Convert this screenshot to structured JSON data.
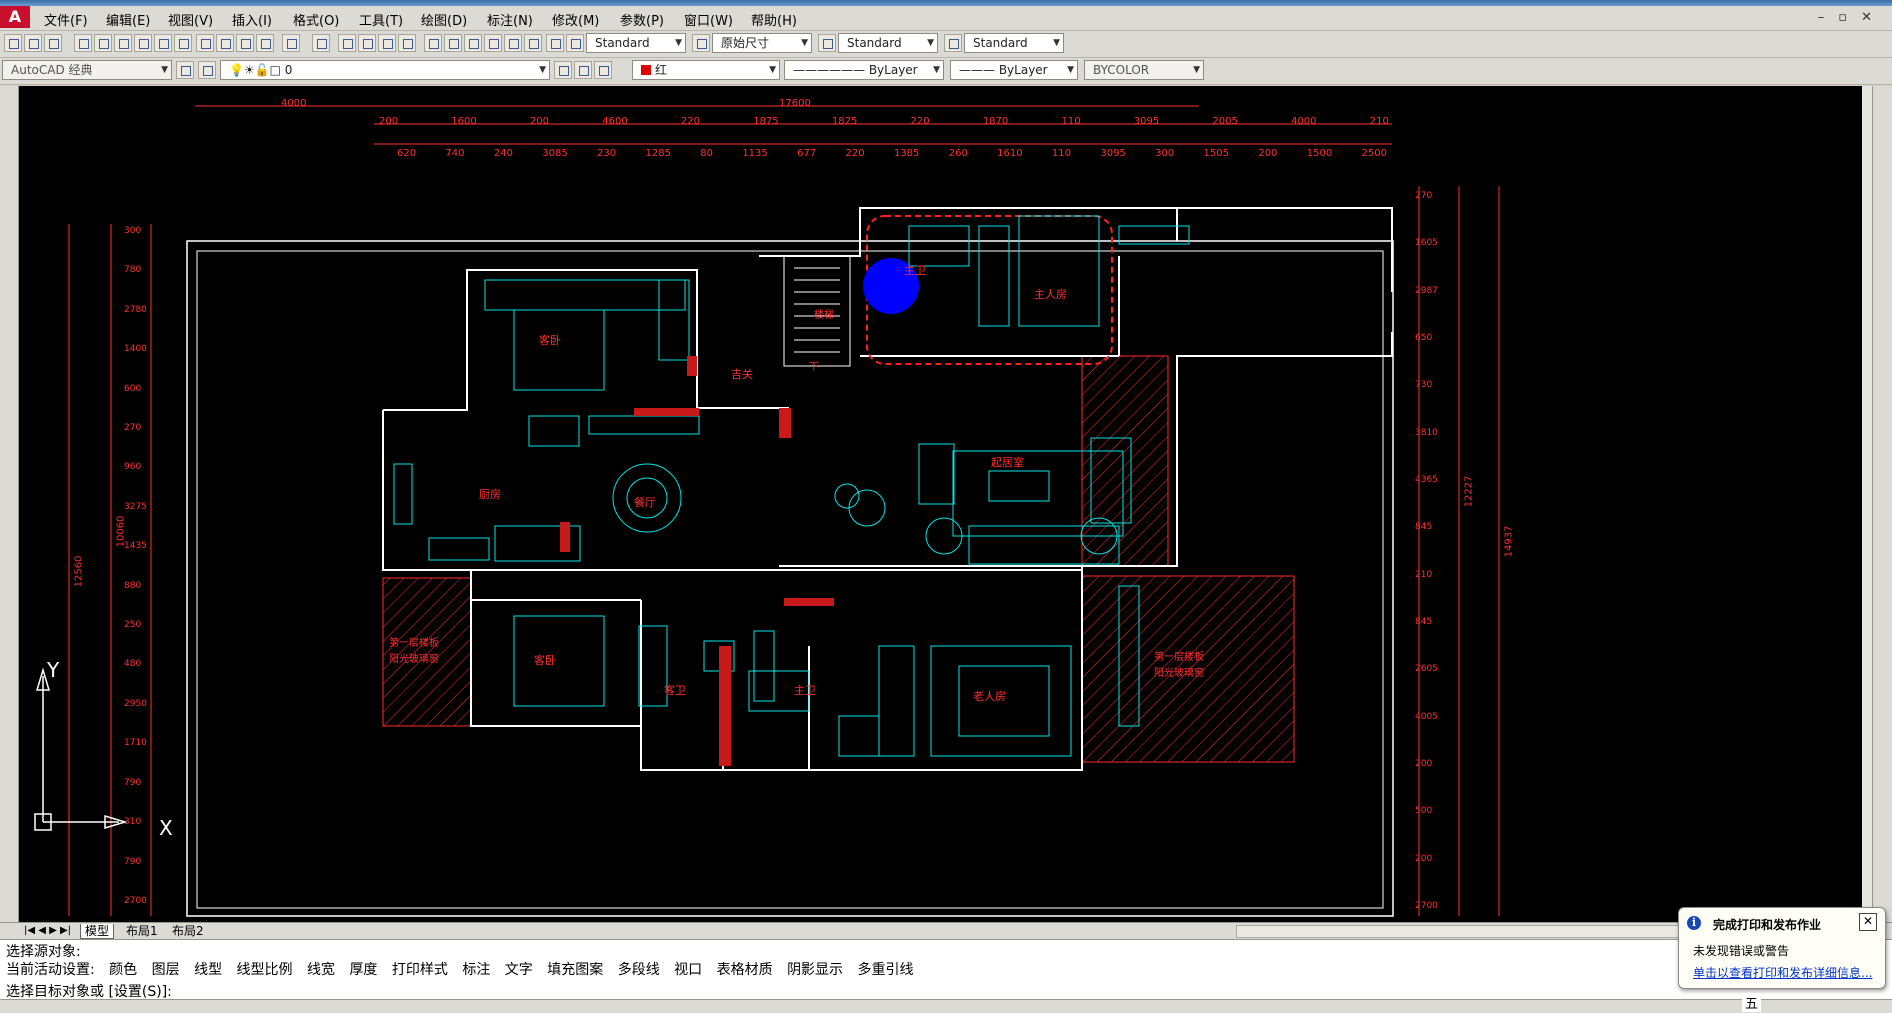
{
  "menubar": {
    "items": [
      "文件(F)",
      "编辑(E)",
      "视图(V)",
      "插入(I)",
      "格式(O)",
      "工具(T)",
      "绘图(D)",
      "标注(N)",
      "修改(M)",
      "参数(P)",
      "窗口(W)",
      "帮助(H)"
    ]
  },
  "toolbar1": {
    "text_style": "Standard",
    "dim_style": "原始尺寸",
    "table_style": "Standard",
    "multileader_style": "Standard"
  },
  "toolbar2": {
    "workspace": "AutoCAD 经典",
    "layer": "0",
    "color": "红",
    "linetype": "ByLayer",
    "lineweight": "ByLayer",
    "plotstyle": "BYCOLOR"
  },
  "drawing": {
    "rooms": [
      "客卧",
      "吉关",
      "主卫",
      "主人房",
      "厨房",
      "餐厅",
      "起居室",
      "客卧",
      "客卫",
      "主卫",
      "老人房",
      "楼梯",
      "下"
    ],
    "notes": [
      "第一层楼板",
      "阳光玻璃窗",
      "第一层楼板",
      "阳光玻璃窗"
    ],
    "dim_top_1": [
      "4000",
      "17600"
    ],
    "dim_top_2": [
      "200",
      "1600",
      "200",
      "4600",
      "220",
      "1875",
      "1825",
      "220",
      "1870",
      "110",
      "3095",
      "2005",
      "4000",
      "210"
    ],
    "dim_top_3": [
      "620",
      "740",
      "240",
      "3085",
      "230",
      "1285",
      "80",
      "1135",
      "677",
      "220",
      "1385",
      "260",
      "1610",
      "110",
      "3095",
      "300",
      "1505",
      "200",
      "1500",
      "2500"
    ],
    "dim_left_total": [
      "12560",
      "10060"
    ],
    "dim_left_parts": [
      "300",
      "780",
      "2780",
      "1400",
      "600",
      "270",
      "960",
      "3275",
      "1435",
      "880",
      "250",
      "480",
      "2950",
      "1710",
      "790",
      "310",
      "790",
      "2700"
    ],
    "dim_right_total": [
      "14937",
      "12227"
    ],
    "dim_right_parts": [
      "270",
      "1605",
      "2987",
      "650",
      "730",
      "3810",
      "4365",
      "845",
      "210",
      "845",
      "2605",
      "4005",
      "200",
      "500",
      "200",
      "2700"
    ],
    "ucs": {
      "y": "Y",
      "x": "X"
    }
  },
  "tabs": [
    "模型",
    "布局1",
    "布局2"
  ],
  "command": {
    "line1": "选择源对象:",
    "line2_prefix": "当前活动设置:",
    "settings": [
      "颜色",
      "图层",
      "线型",
      "线型比例",
      "线宽",
      "厚度",
      "打印样式",
      "标注",
      "文字",
      "填充图案",
      "多段线",
      "视口",
      "表格材质",
      "阴影显示",
      "多重引线"
    ],
    "line3": "选择目标对象或 [设置(S)]:"
  },
  "notification": {
    "title": "完成打印和发布作业",
    "message": "未发现错误或警告",
    "link": "单击以查看打印和发布详细信息..."
  },
  "ime": {
    "label": "五"
  },
  "colors": {
    "canvas": "#000000",
    "wall": "#ffffff",
    "furniture": "#00e5e5",
    "dimension": "#ff2020",
    "highlight": "#0000ff",
    "panel": "#dcdad5"
  }
}
